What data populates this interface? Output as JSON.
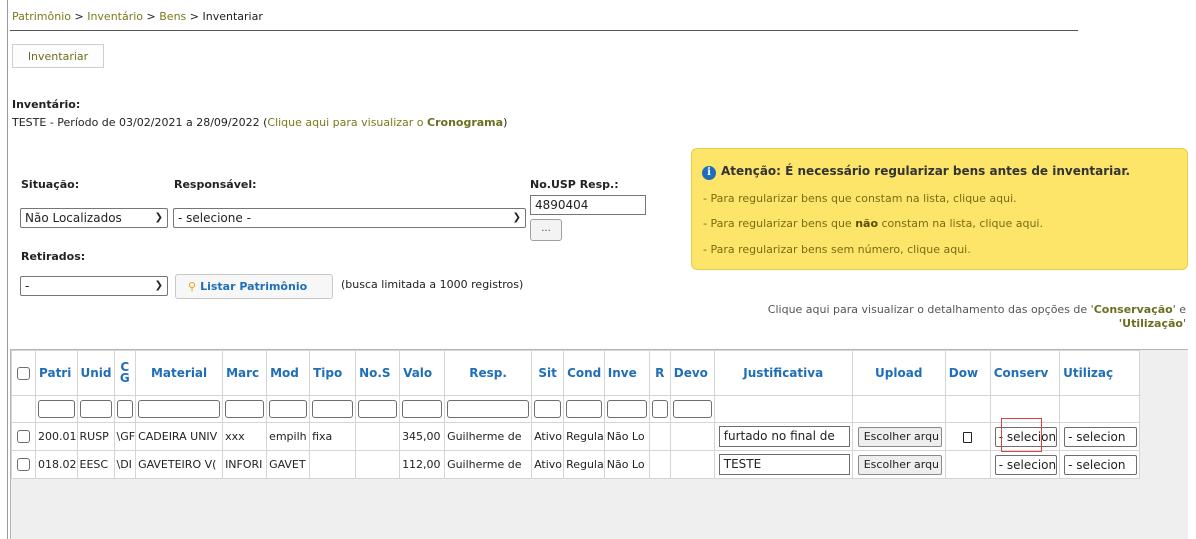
{
  "breadcrumb": {
    "items": [
      "Patrimônio",
      "Inventário",
      "Bens"
    ],
    "current": "Inventariar",
    "separator": ">"
  },
  "tab": {
    "label": "Inventariar"
  },
  "inventory": {
    "title": "Inventário:",
    "desc_prefix": "TESTE - Período de 03/02/2021 a 28/09/2022 (",
    "desc_link": "Clique aqui para visualizar o ",
    "desc_link_bold": "Cronograma",
    "desc_suffix": ")"
  },
  "filters": {
    "situacao_label": "Situação:",
    "situacao_value": "Não Localizados",
    "responsavel_label": "Responsável:",
    "responsavel_value": "- selecione -",
    "nousp_label": "No.USP Resp.:",
    "nousp_value": "4890404",
    "dots_label": "...",
    "retirados_label": "Retirados:",
    "retirados_value": "-",
    "list_button": "Listar Patrimônio",
    "hint": "(busca limitada a 1000 registros)"
  },
  "warning": {
    "title": "Atenção: É necessário regularizar bens antes de inventariar.",
    "line1": "- Para regularizar bens que constam na lista, clique aqui.",
    "line2_pre": "- Para regularizar bens que ",
    "line2_bold": "não",
    "line2_post": " constam na lista, clique aqui.",
    "line3": "- Para regularizar bens sem número, clique aqui.",
    "color": "#fde56a"
  },
  "detail": {
    "pre": "Clique aqui para visualizar o detalhamento das opções de '",
    "b1": "Conservação",
    "mid": "' e",
    "b2": "'Utilização",
    "post": "'"
  },
  "table": {
    "headers": [
      "",
      "Patri",
      "Unid",
      "C\nG",
      "Material",
      "Marc",
      "Mod",
      "Tipo",
      "No.S",
      "Valo",
      "Resp.",
      "Sit",
      "Cond",
      "Inve",
      "R",
      "Devo",
      "Justificativa",
      "Upload",
      "Dow",
      "Conserv",
      "Utilizaç"
    ],
    "rows": [
      {
        "patri": "200.01",
        "unid": "RUSP",
        "cg": "\\GF",
        "material": "CADEIRA UNIV",
        "marca": "xxx",
        "mod": "empilh",
        "tipo": "fixa",
        "nos": "",
        "valor": "345,00",
        "resp": "Guilherme de",
        "sit": "Ativo",
        "cond": "Regula",
        "inve": "Não Lo",
        "r": "",
        "devo": "",
        "justificativa": "furtado no final de",
        "upload": "Escolher arqu",
        "conserv": "- selecion",
        "utilizacao": "- selecion"
      },
      {
        "patri": "018.02",
        "unid": "EESC",
        "cg": "\\DI",
        "material": "GAVETEIRO V(",
        "marca": "INFORI",
        "mod": "GAVET",
        "tipo": "",
        "nos": "",
        "valor": "112,00",
        "resp": "Guilherme de",
        "sit": "Ativo",
        "cond": "Regula",
        "inve": "Não Lo",
        "r": "",
        "devo": "",
        "justificativa": "TESTE",
        "upload": "Escolher arqu",
        "conserv": "- selecion",
        "utilizacao": "- selecion"
      }
    ]
  }
}
